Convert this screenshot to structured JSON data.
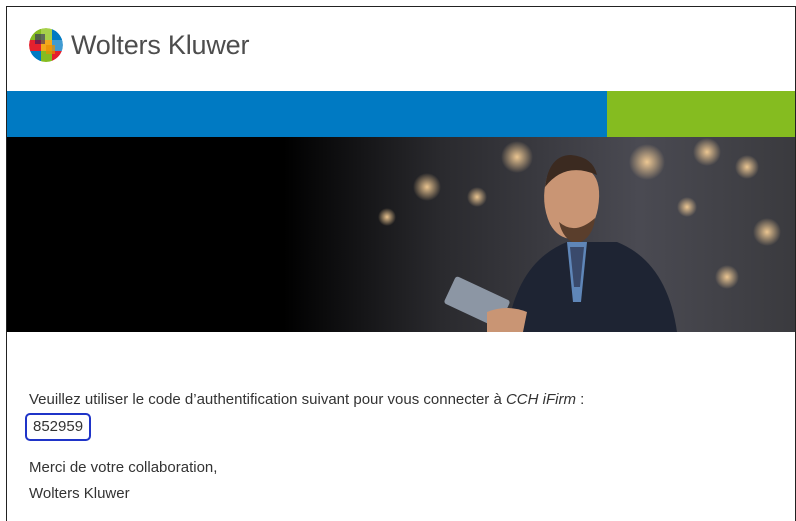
{
  "brand": {
    "name": "Wolters Kluwer",
    "colors": {
      "blue": "#007ac3",
      "green": "#85bc20",
      "text": "#4d4d4d"
    },
    "logo_icon": "wolters-kluwer-logo-icon"
  },
  "hero": {
    "image_icon": "hero-photo"
  },
  "message": {
    "intro": "Veuillez utiliser le code d’authentification suivant pour vous connecter à ",
    "product": "CCH iFirm",
    "intro_suffix": " :",
    "code": "852959",
    "thanks": "Merci de votre collaboration,",
    "signature": "Wolters Kluwer"
  }
}
